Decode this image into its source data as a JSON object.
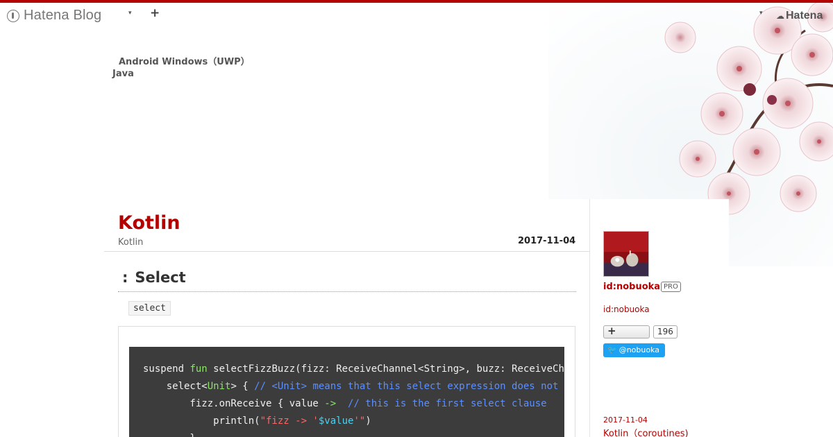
{
  "header": {
    "logo_text": "Hatena Blog",
    "caret": "▾",
    "plus": "+",
    "caret_right": "▾",
    "hatena_label": "Hatena",
    "hatena_cloud": "☁"
  },
  "blog": {
    "desc_line1": "Android Windows（UWP）",
    "desc_line2": "Java"
  },
  "entry": {
    "title": "Kotlin",
    "category": "Kotlin",
    "date": "2017-11-04",
    "section_colon": ":",
    "section_title": "Select",
    "inline_code": "select",
    "code": {
      "l1_a": "suspend ",
      "l1_kw": "fun",
      "l1_b": " selectFizzBuzz(fizz: ReceiveChannel<String>, buzz: ReceiveChannel<String>) {",
      "l2_a": "    select<",
      "l2_tp": "Unit",
      "l2_b": "> { ",
      "l2_cm": "// <Unit> means that this select expression does not produce any result",
      "l3_a": "        fizz.onReceive { value ",
      "l3_arrow": "->",
      "l3_b": "  ",
      "l3_cm": "// this is the first select clause",
      "l4_a": "            println(",
      "l4_st1": "\"fizz -> '",
      "l4_iv": "$value",
      "l4_st2": "'\"",
      "l4_b": ")",
      "l5": "        }"
    }
  },
  "sidebar": {
    "user_id": "id:nobuoka",
    "pro_badge": "PRO",
    "user_id_link": "id:nobuoka",
    "bookmark_plus": "+",
    "bookmark_count": "196",
    "twitter_bird": "🐦",
    "twitter_label": "@nobuoka",
    "recent_date": "2017-11-04",
    "recent_title": "Kotlin（coroutines)"
  },
  "colors": {
    "accent": "#b50000",
    "code_bg": "#3c3c3c",
    "twitter": "#1da1f2"
  }
}
